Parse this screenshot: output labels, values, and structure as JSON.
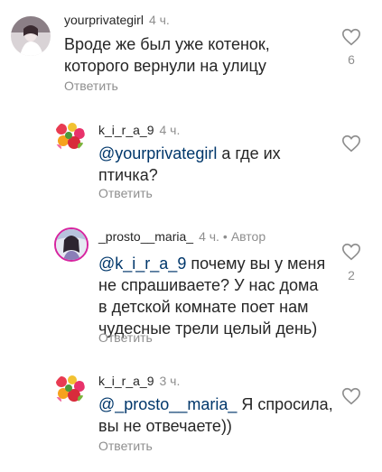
{
  "comments": [
    {
      "username": "yourprivategirl",
      "time": "4 ч.",
      "text": "Вроде же был уже котенок, которого вернули на улицу",
      "reply_label": "Ответить",
      "likes": "6"
    },
    {
      "username": "k_i_r_a_9",
      "time": "4 ч.",
      "mention": "@yourprivategirl",
      "text": " а где их птичка?",
      "reply_label": "Ответить"
    },
    {
      "username": "_prosto__maria_",
      "time": "4 ч.",
      "author_label": "Автор",
      "mention": "@k_i_r_a_9",
      "text": " почему вы у меня не спрашиваете? У нас дома в детской комнате поет нам чудесные трели целый день)",
      "reply_label": "Ответить",
      "likes": "2"
    },
    {
      "username": "k_i_r_a_9",
      "time": "3 ч.",
      "mention": "@_prosto__maria_",
      "text": " Я спросила, вы не отвечаете))",
      "reply_label": "Ответить"
    }
  ]
}
